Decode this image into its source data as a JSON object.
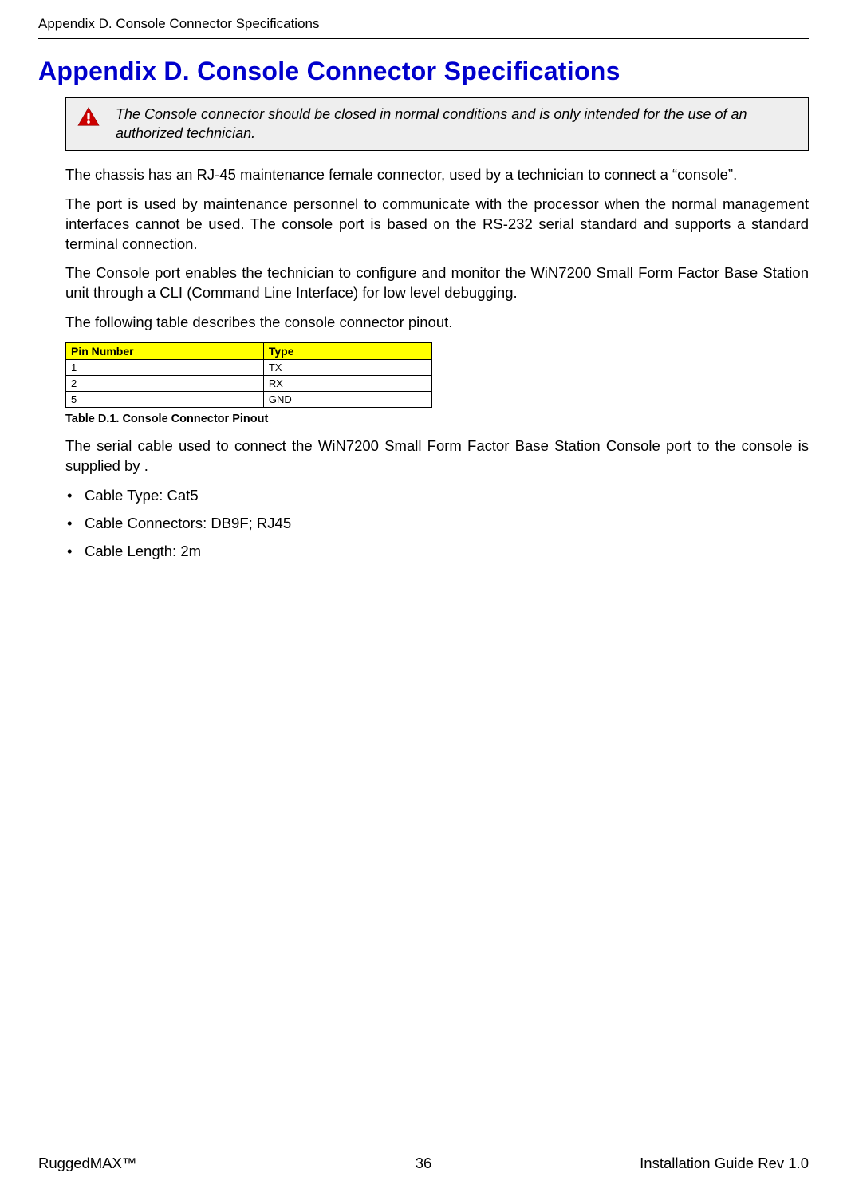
{
  "header": {
    "breadcrumb": "Appendix D. Console Connector Specifications"
  },
  "title": "Appendix D. Console Connector Specifications",
  "alert": {
    "text": "The Console connector should be closed in normal conditions and is only intended for the use of an authorized technician."
  },
  "paragraphs": {
    "p1": "The chassis has an RJ-45 maintenance female connector, used by a technician to connect a “console”.",
    "p2": "The port is used by maintenance personnel to communicate with the processor when the normal management interfaces cannot be used. The console port is based on the RS-232 serial standard and supports a standard terminal connection.",
    "p3": "The Console port enables the technician to configure and monitor the WiN7200 Small Form Factor Base Station unit through a CLI (Command Line Interface) for low level debugging.",
    "p4": "The following table describes the console connector pinout."
  },
  "table": {
    "headers": {
      "pin": "Pin Number",
      "type": "Type"
    },
    "rows": [
      {
        "pin": "1",
        "type": "TX"
      },
      {
        "pin": "2",
        "type": "RX"
      },
      {
        "pin": "5",
        "type": "GND"
      }
    ],
    "caption": "Table D.1. Console Connector Pinout"
  },
  "paragraphs2": {
    "p5": "The serial cable used to connect the WiN7200 Small Form Factor Base Station Console port to the console is supplied by ."
  },
  "bullets": [
    "Cable Type: Cat5",
    "Cable Connectors: DB9F; RJ45",
    "Cable Length: 2m"
  ],
  "footer": {
    "left": "RuggedMAX™",
    "center": "36",
    "right": "Installation Guide Rev 1.0"
  }
}
